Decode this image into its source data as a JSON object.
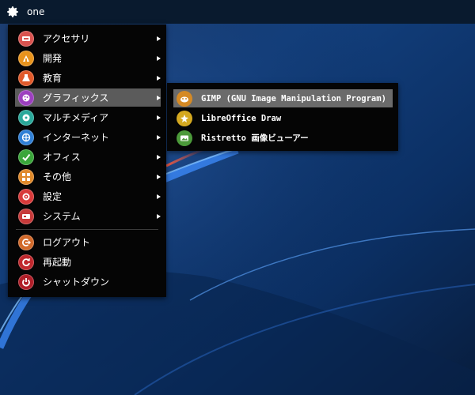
{
  "topbar": {
    "menu_icon": "gear-icon",
    "title": "one"
  },
  "main_menu": {
    "items": [
      {
        "label": "アクセサリ",
        "icon": "accessories-icon",
        "color": "#d9534f",
        "has_submenu": true
      },
      {
        "label": "開発",
        "icon": "development-icon",
        "color": "#e8931c",
        "has_submenu": true
      },
      {
        "label": "教育",
        "icon": "education-icon",
        "color": "#e05a2a",
        "has_submenu": true
      },
      {
        "label": "グラフィックス",
        "icon": "graphics-icon",
        "color": "#9c3fbf",
        "has_submenu": true,
        "selected": true
      },
      {
        "label": "マルチメディア",
        "icon": "multimedia-icon",
        "color": "#2aa89a",
        "has_submenu": true
      },
      {
        "label": "インターネット",
        "icon": "internet-icon",
        "color": "#2f7fd6",
        "has_submenu": true
      },
      {
        "label": "オフィス",
        "icon": "office-icon",
        "color": "#3aa63a",
        "has_submenu": true
      },
      {
        "label": "その他",
        "icon": "other-icon",
        "color": "#e0892a",
        "has_submenu": true
      },
      {
        "label": "設定",
        "icon": "settings-icon",
        "color": "#d83a3a",
        "has_submenu": true
      },
      {
        "label": "システム",
        "icon": "system-icon",
        "color": "#c73a3a",
        "has_submenu": true
      }
    ],
    "actions": [
      {
        "label": "ログアウト",
        "icon": "logout-icon",
        "color": "#d2692a"
      },
      {
        "label": "再起動",
        "icon": "restart-icon",
        "color": "#c0282d"
      },
      {
        "label": "シャットダウン",
        "icon": "shutdown-icon",
        "color": "#b01e28"
      }
    ]
  },
  "graphics_submenu": {
    "items": [
      {
        "label": "GIMP (GNU Image Manipulation Program)",
        "icon": "gimp-icon",
        "color": "#d58a25",
        "selected": true
      },
      {
        "label": "LibreOffice Draw",
        "icon": "libreoffice-draw-icon",
        "color": "#d4a820"
      },
      {
        "label": "Ristretto 画像ビューアー",
        "icon": "ristretto-icon",
        "color": "#4c9a3a"
      }
    ]
  }
}
